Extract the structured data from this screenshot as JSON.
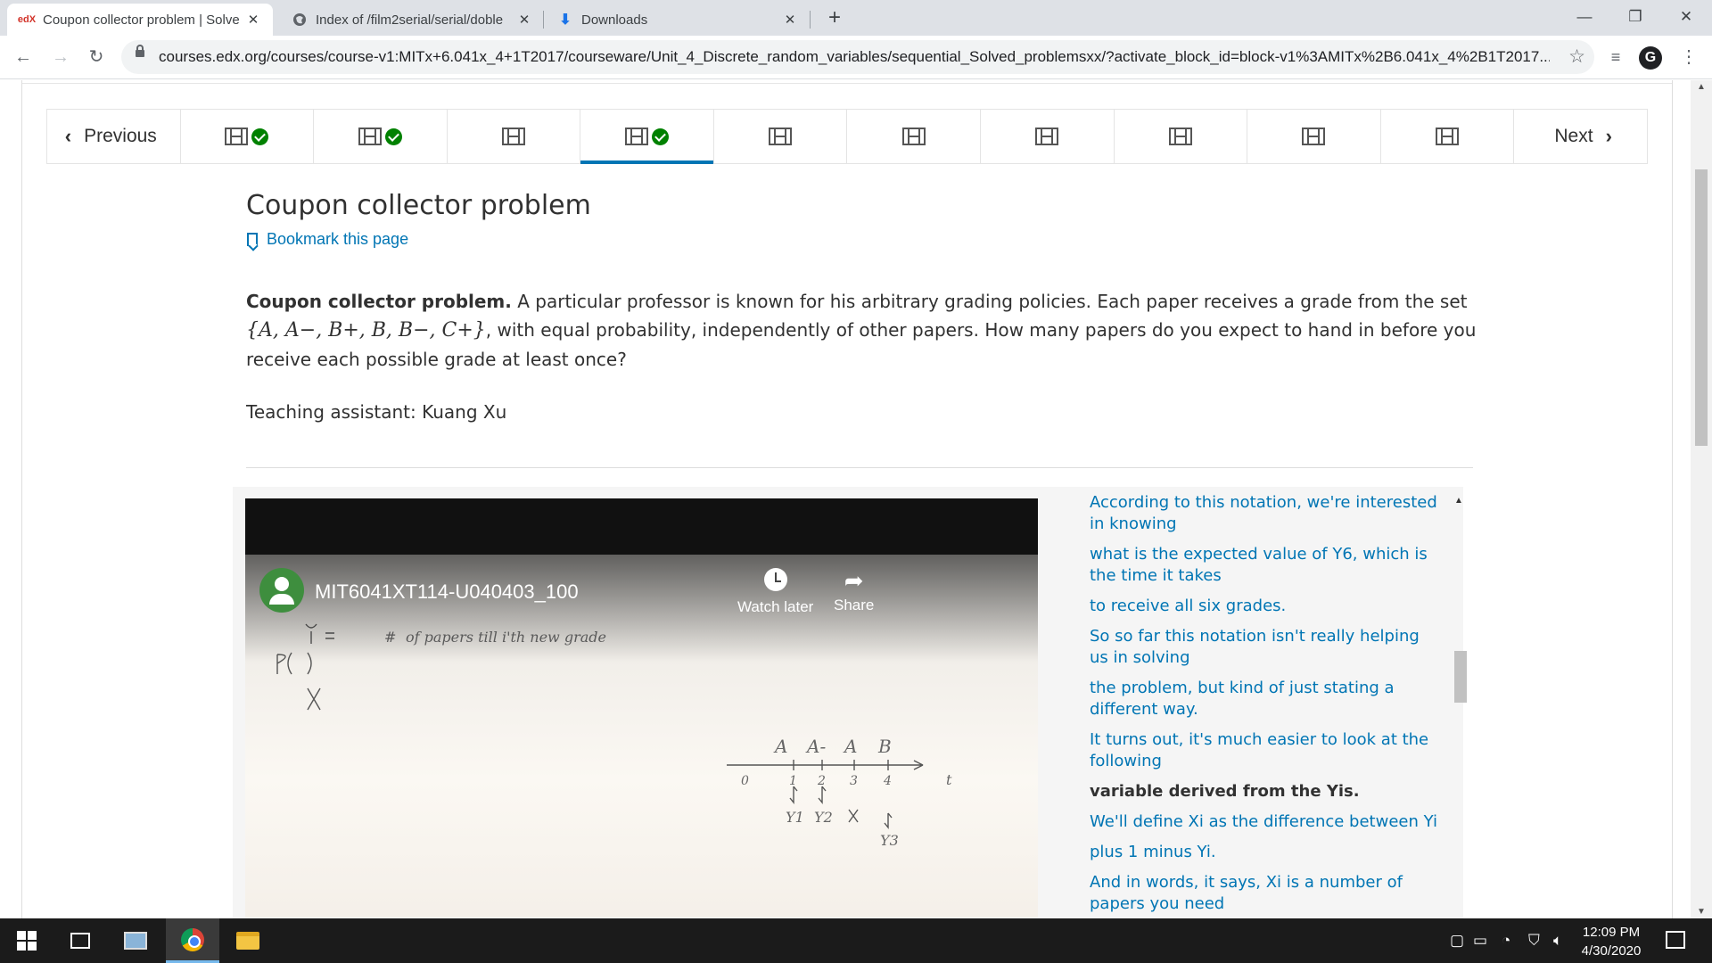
{
  "browser": {
    "tabs": [
      {
        "favicon": "edX",
        "title": "Coupon collector problem | Solve",
        "active": true
      },
      {
        "favicon": "globe-icon",
        "title": "Index of /film2serial/serial/doble",
        "active": false
      },
      {
        "favicon": "download-icon",
        "title": "Downloads",
        "active": false
      }
    ],
    "new_tab": "+",
    "window_controls": {
      "minimize": "—",
      "restore": "❐",
      "close": "✕"
    },
    "url": "courses.edx.org/courses/course-v1:MITx+6.041x_4+1T2017/courseware/Unit_4_Discrete_random_variables/sequential_Solved_problemsxx/?activate_block_id=block-v1%3AMITx%2B6.041x_4%2B1T2017..."
  },
  "sequence_nav": {
    "previous_label": "Previous",
    "next_label": "Next",
    "items": [
      {
        "type": "video",
        "completed": true,
        "active": false
      },
      {
        "type": "video",
        "completed": true,
        "active": false
      },
      {
        "type": "video",
        "completed": false,
        "active": false
      },
      {
        "type": "video",
        "completed": true,
        "active": true
      },
      {
        "type": "video",
        "completed": false,
        "active": false
      },
      {
        "type": "video",
        "completed": false,
        "active": false
      },
      {
        "type": "video",
        "completed": false,
        "active": false
      },
      {
        "type": "video",
        "completed": false,
        "active": false
      },
      {
        "type": "video",
        "completed": false,
        "active": false
      },
      {
        "type": "video",
        "completed": false,
        "active": false
      }
    ]
  },
  "unit": {
    "title": "Coupon collector problem",
    "bookmark_label": "Bookmark this page",
    "problem_bold": "Coupon collector problem.",
    "problem_text_1": " A particular professor is known for his arbitrary grading policies. Each paper receives a grade from the set ",
    "problem_set": "{A, A−, B+, B, B−, C+}",
    "problem_text_2": ", with equal probability, independently of other papers. How many papers do you expect to hand in before you receive each possible grade at least once?",
    "teaching_assistant": "Teaching assistant: Kuang Xu"
  },
  "video": {
    "title": "MIT6041XT114-U040403_100",
    "watch_later": "Watch later",
    "share": "Share"
  },
  "transcript": [
    {
      "text": "According to this notation, we're interested in knowing",
      "current": false
    },
    {
      "text": "what is the expected value of Y6, which is the time it takes",
      "current": false
    },
    {
      "text": "to receive all six grades.",
      "current": false
    },
    {
      "text": "So so far this notation isn't really helping us in solving",
      "current": false
    },
    {
      "text": "the problem, but kind of just stating a different way.",
      "current": false
    },
    {
      "text": "It turns out, it's much easier to look at the following",
      "current": false
    },
    {
      "text": "variable derived from the Yis.",
      "current": true
    },
    {
      "text": "We'll define Xi as the difference between Yi",
      "current": false
    },
    {
      "text": "plus 1 minus Yi.",
      "current": false
    },
    {
      "text": "And in words, it says, Xi is a number of papers you need",
      "current": false
    }
  ],
  "taskbar": {
    "time": "12:09 PM",
    "date": "4/30/2020"
  },
  "colors": {
    "link": "#0075b4",
    "completed": "#008100",
    "active_indicator": "#0075b4"
  }
}
